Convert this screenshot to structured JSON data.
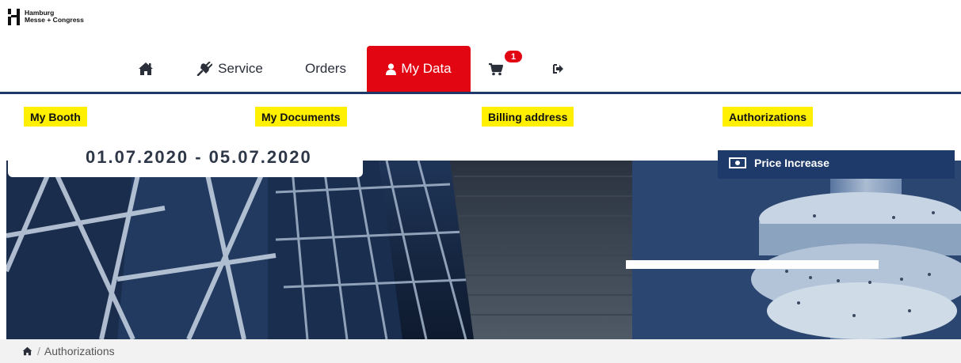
{
  "logo": {
    "line1": "Hamburg",
    "line2": "Messe + Congress"
  },
  "nav": {
    "home_icon": "home-icon",
    "service_icon": "plug-icon",
    "service_label": "Service",
    "orders_label": "Orders",
    "mydata_icon": "user-icon",
    "mydata_label": "My Data",
    "cart_icon": "cart-icon",
    "cart_badge": "1",
    "logout_icon": "logout-icon"
  },
  "subnav": {
    "items": [
      {
        "label": "My Booth"
      },
      {
        "label": "My Documents"
      },
      {
        "label": "Billing address"
      },
      {
        "label": "Authorizations"
      }
    ]
  },
  "hero": {
    "date_range": "01.07.2020 - 05.07.2020",
    "price_label": "Price Increase",
    "price_icon": "money-icon"
  },
  "breadcrumb": {
    "home_icon": "home-icon",
    "separator": "/",
    "current": "Authorizations"
  },
  "colors": {
    "active_tab": "#e20613",
    "nav_line": "#1d3a6b",
    "highlight": "#ffef00",
    "price_box": "#1d3a6b",
    "breadcrumb_bg": "#f2f2f2"
  }
}
